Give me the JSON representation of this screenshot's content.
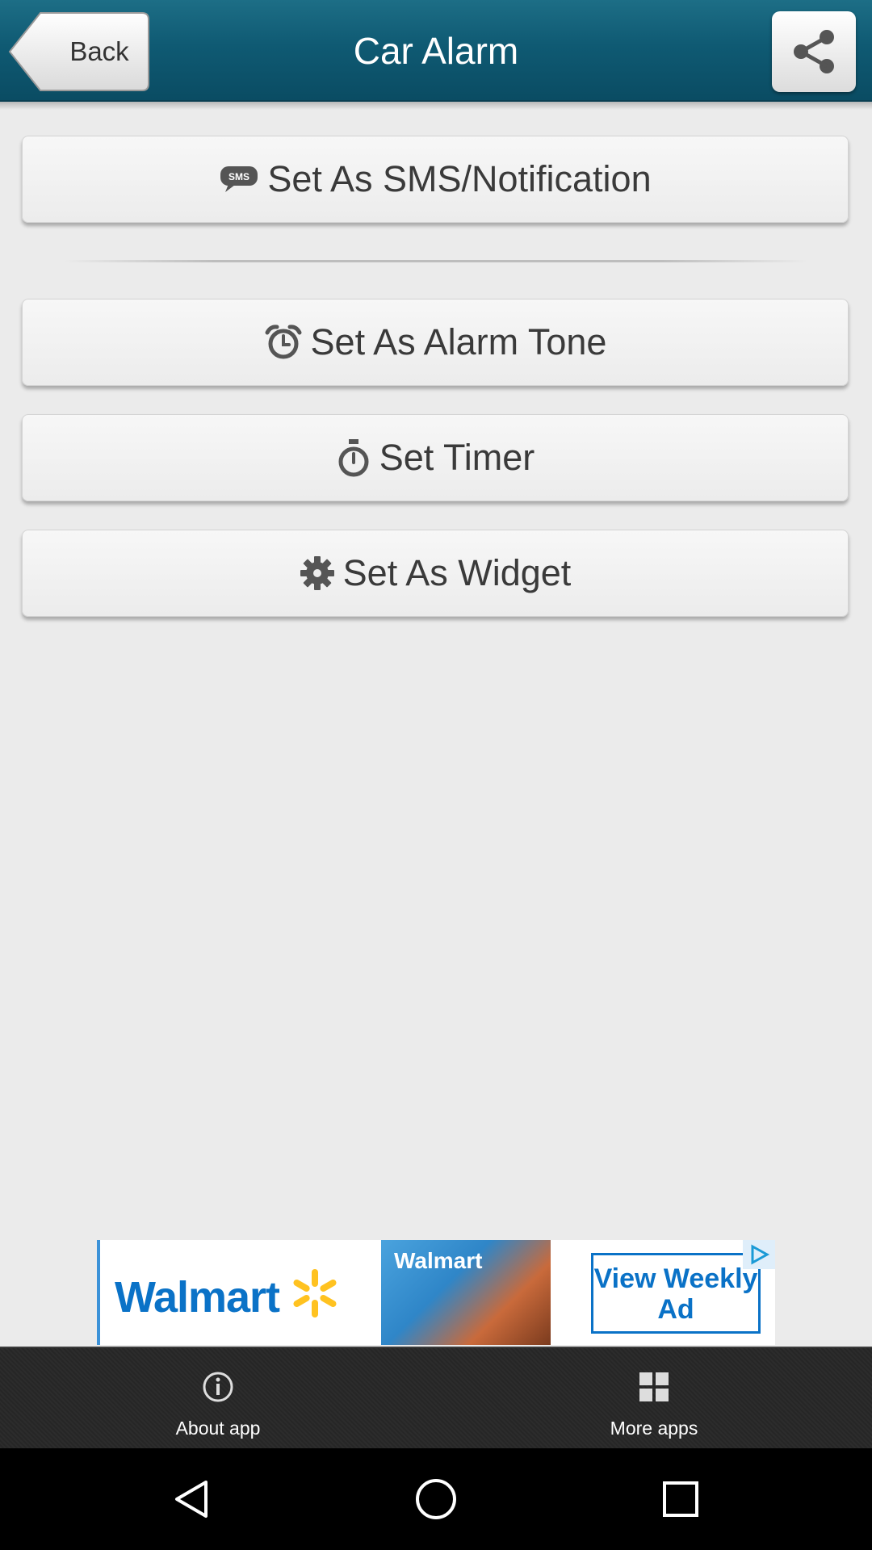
{
  "header": {
    "back_label": "Back",
    "title": "Car Alarm",
    "share_icon": "share-icon"
  },
  "actions": [
    {
      "label": "Set As SMS/Notification",
      "icon": "sms-icon"
    },
    {
      "label": "Set As Alarm Tone",
      "icon": "alarm-clock-icon"
    },
    {
      "label": "Set Timer",
      "icon": "stopwatch-icon"
    },
    {
      "label": "Set As Widget",
      "icon": "gear-icon"
    }
  ],
  "ad": {
    "brand": "Walmart",
    "photo_text": "Walmart",
    "cta": "View Weekly Ad"
  },
  "bottom_bar": {
    "about": {
      "label": "About app",
      "icon": "info-icon"
    },
    "more": {
      "label": "More apps",
      "icon": "grid-icon"
    }
  },
  "nav": [
    "back-triangle-icon",
    "home-circle-icon",
    "recents-square-icon"
  ],
  "colors": {
    "header": "#0f5a73",
    "background": "#ebebeb",
    "text": "#3a3a3a",
    "bottom_bar": "#2a2a2a"
  }
}
